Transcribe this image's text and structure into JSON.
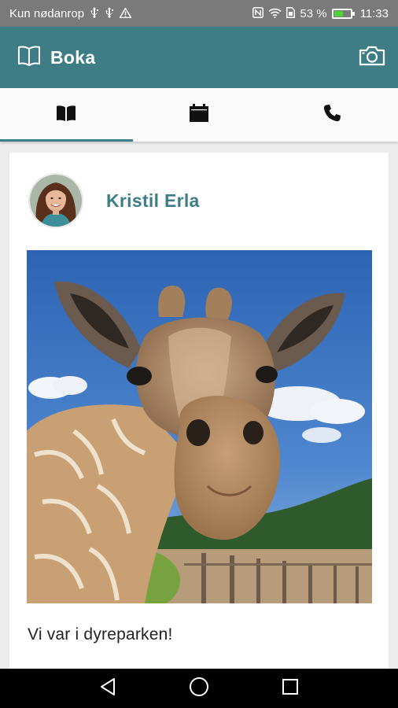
{
  "status_bar": {
    "carrier_text": "Kun nødanrop",
    "battery_text": "53 %",
    "time": "11:33",
    "battery_level": 0.53
  },
  "app_bar": {
    "title": "Boka",
    "book_icon": "book-open-icon",
    "camera_icon": "camera-icon"
  },
  "tabs": [
    {
      "icon": "book-icon",
      "active": true
    },
    {
      "icon": "calendar-icon",
      "active": false
    },
    {
      "icon": "phone-icon",
      "active": false
    }
  ],
  "post": {
    "author_name": "Kristil Erla",
    "caption": "Vi var i dyreparken!"
  },
  "nav_bar": {
    "back_icon": "back-triangle-icon",
    "home_icon": "home-circle-icon",
    "recents_icon": "recents-square-icon"
  },
  "colors": {
    "accent": "#3e7d85",
    "status_bar": "#7a7a7a",
    "nav_bar": "#000000"
  }
}
